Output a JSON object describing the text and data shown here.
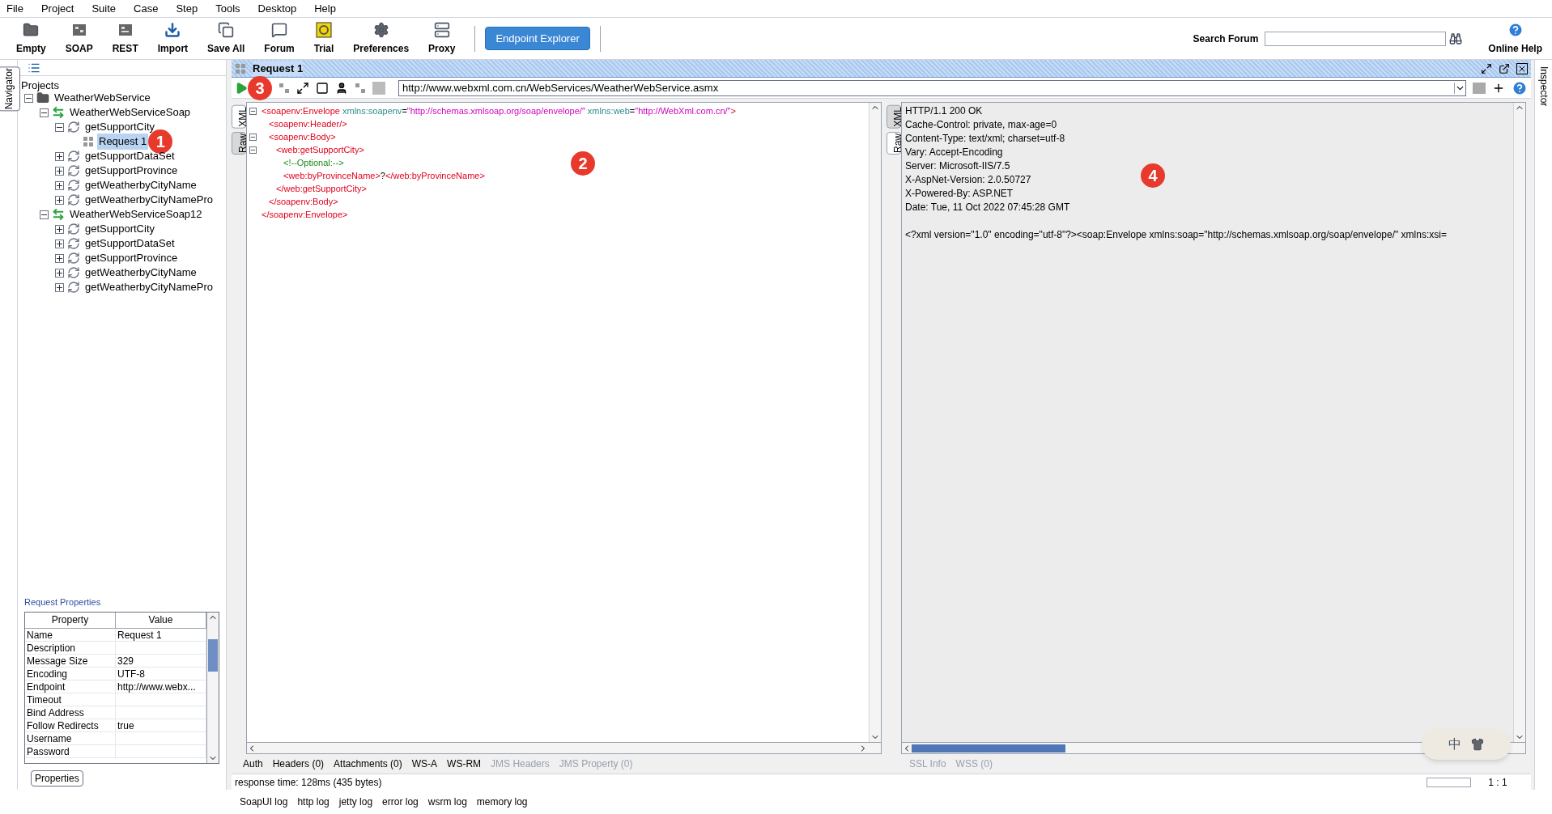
{
  "menu": [
    "File",
    "Project",
    "Suite",
    "Case",
    "Step",
    "Tools",
    "Desktop",
    "Help"
  ],
  "toolbar": [
    {
      "label": "Empty",
      "kind": "empty"
    },
    {
      "label": "SOAP",
      "kind": "soap"
    },
    {
      "label": "REST",
      "kind": "rest"
    },
    {
      "label": "Import",
      "kind": "import"
    },
    {
      "label": "Save All",
      "kind": "saveall"
    },
    {
      "label": "Forum",
      "kind": "forum"
    },
    {
      "label": "Trial",
      "kind": "trial"
    },
    {
      "label": "Preferences",
      "kind": "preferences"
    },
    {
      "label": "Proxy",
      "kind": "proxy"
    }
  ],
  "endpoint_button": "Endpoint Explorer",
  "search": {
    "label": "Search Forum"
  },
  "online_help": "Online Help",
  "navigator_tab": "Navigator",
  "inspector_tab": "Inspector",
  "tree": {
    "root_label": "Projects",
    "nodes": [
      {
        "label": "WeatherWebService",
        "kind": "project",
        "expanded": true,
        "selected": false,
        "children": [
          {
            "label": "WeatherWebServiceSoap",
            "kind": "interface",
            "expanded": true,
            "selected": false,
            "children": [
              {
                "label": "getSupportCity",
                "kind": "operation",
                "expanded": true,
                "selected": false,
                "children": [
                  {
                    "label": "Request 1",
                    "kind": "request",
                    "selected": true,
                    "marker": "1"
                  }
                ]
              },
              {
                "label": "getSupportDataSet",
                "kind": "operation",
                "expanded": false,
                "selected": false
              },
              {
                "label": "getSupportProvince",
                "kind": "operation",
                "expanded": false,
                "selected": false
              },
              {
                "label": "getWeatherbyCityName",
                "kind": "operation",
                "expanded": false,
                "selected": false
              },
              {
                "label": "getWeatherbyCityNamePro",
                "kind": "operation",
                "expanded": false,
                "selected": false
              }
            ]
          },
          {
            "label": "WeatherWebServiceSoap12",
            "kind": "interface",
            "expanded": true,
            "selected": false,
            "children": [
              {
                "label": "getSupportCity",
                "kind": "operation",
                "expanded": false,
                "selected": false
              },
              {
                "label": "getSupportDataSet",
                "kind": "operation",
                "expanded": false,
                "selected": false
              },
              {
                "label": "getSupportProvince",
                "kind": "operation",
                "expanded": false,
                "selected": false
              },
              {
                "label": "getWeatherbyCityName",
                "kind": "operation",
                "expanded": false,
                "selected": false
              },
              {
                "label": "getWeatherbyCityNamePro",
                "kind": "operation",
                "expanded": false,
                "selected": false
              }
            ]
          }
        ]
      }
    ]
  },
  "properties": {
    "title": "Request Properties",
    "columns": [
      "Property",
      "Value"
    ],
    "rows": [
      [
        "Name",
        "Request 1"
      ],
      [
        "Description",
        ""
      ],
      [
        "Message Size",
        "329"
      ],
      [
        "Encoding",
        "UTF-8"
      ],
      [
        "Endpoint",
        "http://www.webx..."
      ],
      [
        "Timeout",
        ""
      ],
      [
        "Bind Address",
        ""
      ],
      [
        "Follow Redirects",
        "true"
      ],
      [
        "Username",
        ""
      ],
      [
        "Password",
        ""
      ]
    ],
    "button": "Properties"
  },
  "request_panel": {
    "title": "Request 1",
    "marker": "3",
    "endpoint": "http://www.webxml.com.cn/WebServices/WeatherWebService.asmx"
  },
  "request_editor": {
    "tabs": [
      {
        "label": "XML",
        "selected": true
      },
      {
        "label": "Raw",
        "selected": false
      }
    ],
    "marker": "2",
    "lines": [
      {
        "fold": true,
        "tokens": [
          {
            "kind": "tag",
            "text": "<soapenv:Envelope"
          },
          {
            "kind": "attr",
            "text": " xmlns:soapenv"
          },
          {
            "kind": "text",
            "text": "="
          },
          {
            "kind": "value",
            "text": "\"http://schemas.xmlsoap.org/soap/envelope/\""
          },
          {
            "kind": "attr",
            "text": " xmlns:web"
          },
          {
            "kind": "text",
            "text": "="
          },
          {
            "kind": "value",
            "text": "\"http://WebXml.com.cn/\""
          },
          {
            "kind": "tag",
            "text": ">"
          }
        ],
        "children": [
          {
            "fold": false,
            "tokens": [
              {
                "kind": "tag",
                "text": "<soapenv:Header/>"
              }
            ]
          },
          {
            "fold": true,
            "tokens": [
              {
                "kind": "tag",
                "text": "<soapenv:Body>"
              }
            ],
            "children": [
              {
                "fold": true,
                "tokens": [
                  {
                    "kind": "tag",
                    "text": "<web:getSupportCity>"
                  }
                ],
                "children": [
                  {
                    "fold": false,
                    "tokens": [
                      {
                        "kind": "comment",
                        "text": "<!--Optional:-->"
                      }
                    ]
                  },
                  {
                    "fold": false,
                    "tokens": [
                      {
                        "kind": "tag",
                        "text": "<web:byProvinceName>"
                      },
                      {
                        "kind": "text",
                        "text": "?"
                      },
                      {
                        "kind": "tag",
                        "text": "</web:byProvinceName>"
                      }
                    ]
                  }
                ]
              },
              {
                "fold": false,
                "tokens": [
                  {
                    "kind": "tag",
                    "text": "</web:getSupportCity>"
                  }
                ]
              }
            ]
          },
          {
            "fold": false,
            "tokens": [
              {
                "kind": "tag",
                "text": "</soapenv:Body>"
              }
            ]
          }
        ]
      },
      {
        "fold": false,
        "tokens": [
          {
            "kind": "tag",
            "text": "</soapenv:Envelope>"
          }
        ]
      }
    ]
  },
  "request_tabs": [
    {
      "label": "Auth",
      "disabled": false
    },
    {
      "label": "Headers (0)",
      "disabled": false
    },
    {
      "label": "Attachments (0)",
      "disabled": false
    },
    {
      "label": "WS-A",
      "disabled": false
    },
    {
      "label": "WS-RM",
      "disabled": false
    },
    {
      "label": "JMS Headers",
      "disabled": true
    },
    {
      "label": "JMS Property (0)",
      "disabled": true
    }
  ],
  "response_editor": {
    "tabs": [
      {
        "label": "XML",
        "selected": false
      },
      {
        "label": "Raw",
        "selected": true
      }
    ],
    "marker": "4",
    "headers": [
      "HTTP/1.1 200 OK",
      "Cache-Control: private, max-age=0",
      "Content-Type: text/xml; charset=utf-8",
      "Vary: Accept-Encoding",
      "Server: Microsoft-IIS/7.5",
      "X-AspNet-Version: 2.0.50727",
      "X-Powered-By: ASP.NET",
      "Date: Tue, 11 Oct 2022 07:45:28 GMT"
    ],
    "body": "<?xml version=\"1.0\" encoding=\"utf-8\"?><soap:Envelope xmlns:soap=\"http://schemas.xmlsoap.org/soap/envelope/\" xmlns:xsi="
  },
  "response_tabs": [
    {
      "label": "SSL Info",
      "disabled": true
    },
    {
      "label": "WSS (0)",
      "disabled": true
    }
  ],
  "status": {
    "response_time": "response time: 128ms (435 bytes)",
    "position": "1 : 1"
  },
  "ime_widget": {
    "label": "中"
  },
  "log_tabs": [
    "SoapUI log",
    "http log",
    "jetty log",
    "error log",
    "wsrm log",
    "memory log"
  ]
}
